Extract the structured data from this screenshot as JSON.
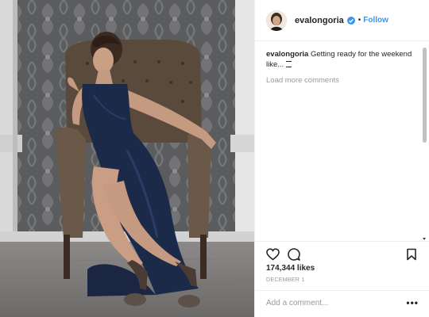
{
  "header": {
    "username": "evalongoria",
    "separator": "•",
    "follow_label": "Follow",
    "verified_icon": "verified-badge-icon"
  },
  "caption": {
    "username": "evalongoria",
    "text": "Getting ready for the weekend like... "
  },
  "comments": {
    "load_more_label": "Load more comments"
  },
  "actions": {
    "like_icon": "heart-icon",
    "comment_icon": "comment-bubble-icon",
    "save_icon": "bookmark-icon"
  },
  "likes": {
    "count_text": "174,344 likes"
  },
  "date": {
    "text": "DECEMBER 1"
  },
  "comment_bar": {
    "placeholder": "Add a comment...",
    "more_label": "•••"
  },
  "colors": {
    "accent": "#3897f0",
    "text": "#262626",
    "muted": "#999999",
    "dress": "#1c2a4a",
    "wallpaper": "#5d5e60"
  }
}
